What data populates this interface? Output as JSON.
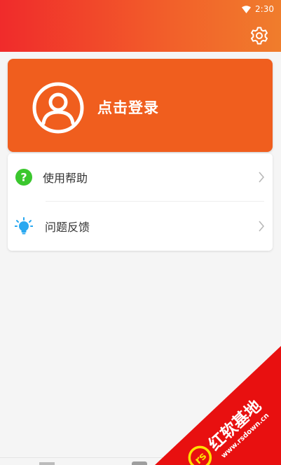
{
  "status_bar": {
    "time": "2:30",
    "wifi_icon": "wifi-icon"
  },
  "header": {
    "settings_icon": "gear-icon",
    "color": "#f04a2a"
  },
  "login_card": {
    "label": "点击登录",
    "avatar_icon": "user-avatar-icon",
    "color": "#f05e1e"
  },
  "menu": {
    "items": [
      {
        "label": "使用帮助",
        "icon": "question-icon",
        "icon_color": "#3bc72e"
      },
      {
        "label": "问题反馈",
        "icon": "lightbulb-icon",
        "icon_color": "#29a8f0"
      }
    ]
  },
  "watermark": {
    "brand": "红软基地",
    "url": "www.rsdown.cn"
  }
}
